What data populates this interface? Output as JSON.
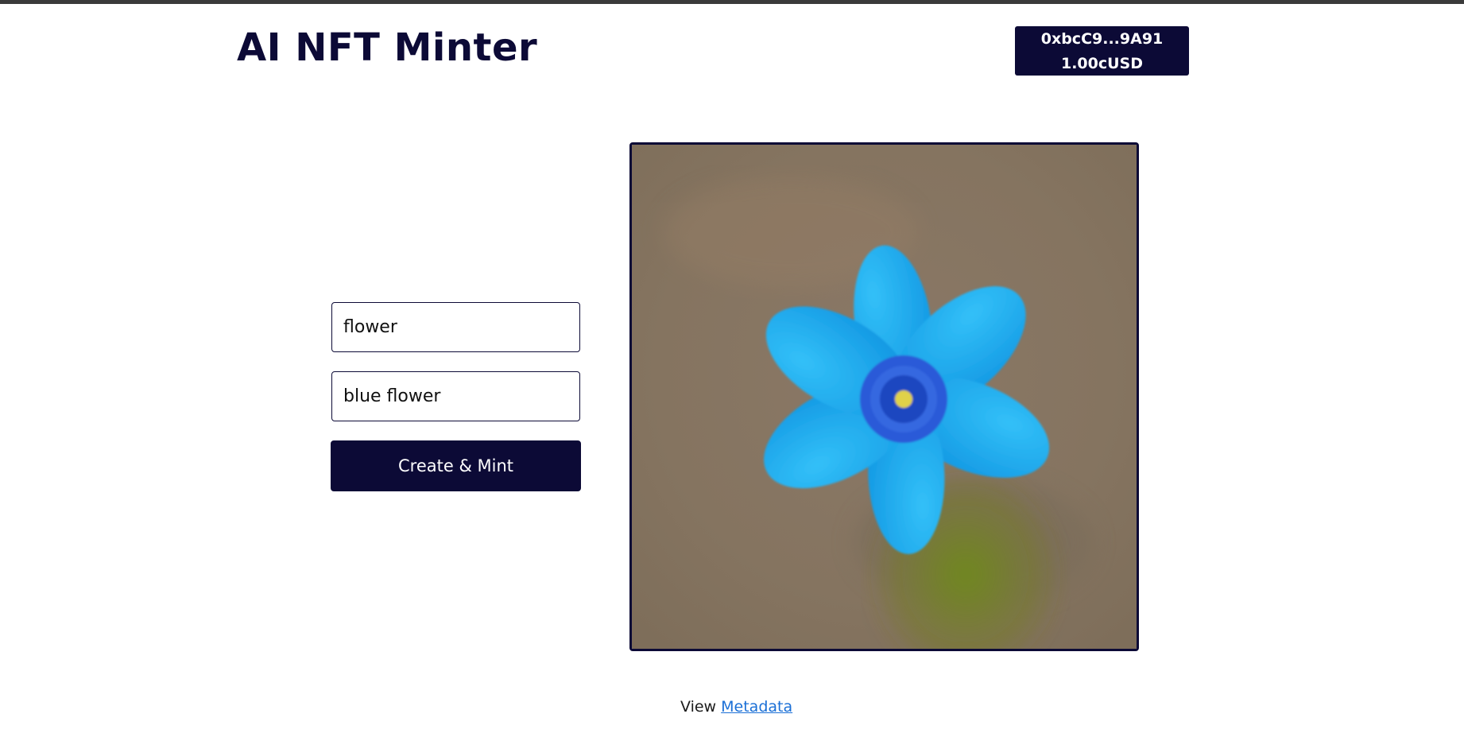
{
  "app": {
    "title": "AI NFT Minter"
  },
  "wallet": {
    "address": "0xbcC9...9A91",
    "balance": "1.00cUSD"
  },
  "form": {
    "name_value": "flower",
    "description_value": "blue flower",
    "submit_label": "Create & Mint"
  },
  "preview": {
    "image_subject": "blue-flower-image"
  },
  "footer": {
    "view_label": "View",
    "metadata_link": "Metadata"
  },
  "colors": {
    "primary": "#0c0a36",
    "link": "#1a6fd6",
    "flower_petal": "#1aa6ee",
    "flower_center": "#2a5ad8",
    "background_photo": "#8b7a66"
  }
}
